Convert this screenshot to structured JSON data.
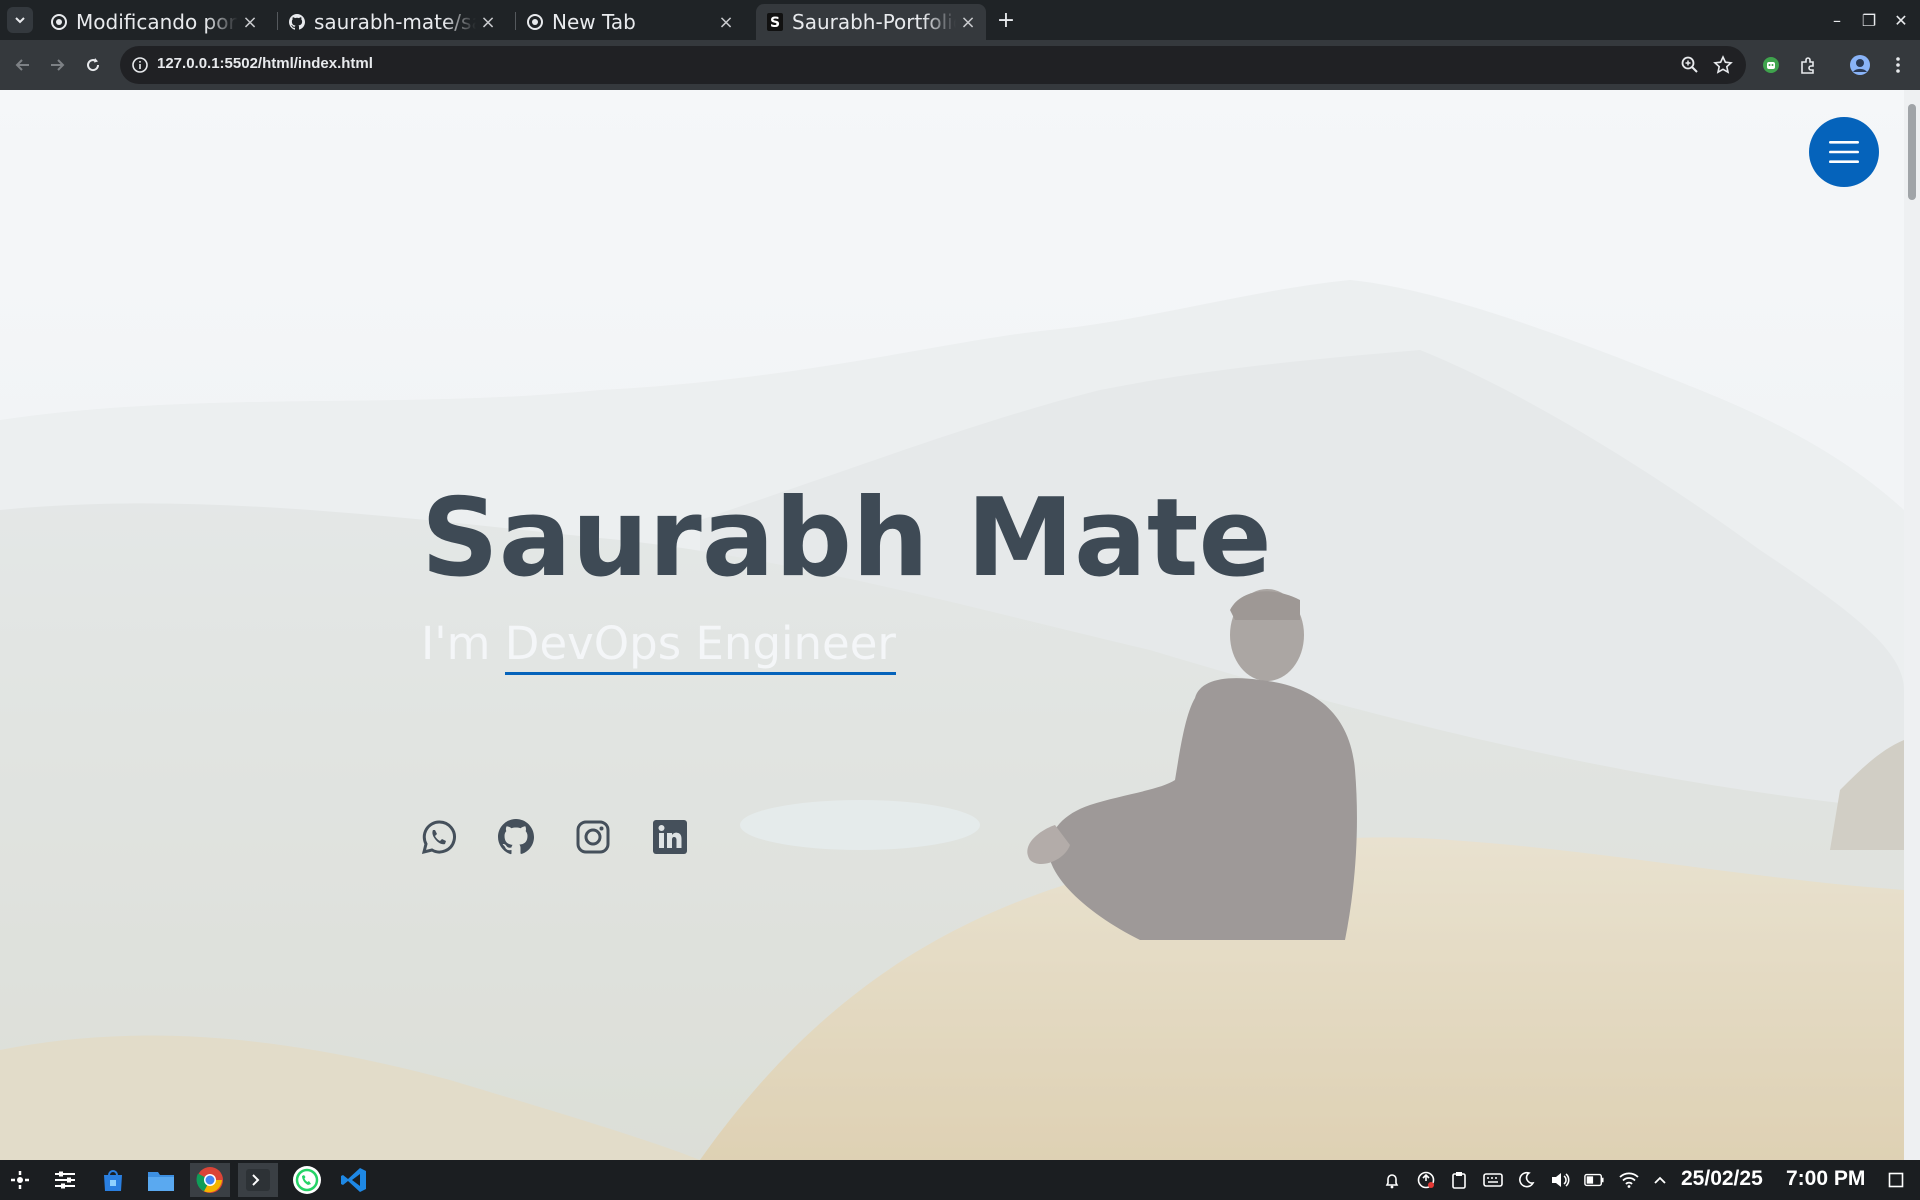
{
  "browser": {
    "tabs": [
      {
        "title": "Modificando portfolio",
        "favicon": "chrome-icon",
        "active": false
      },
      {
        "title": "saurabh-mate/saurabh-mate",
        "favicon": "github-icon",
        "active": false
      },
      {
        "title": "New Tab",
        "favicon": "chrome-icon",
        "active": false
      },
      {
        "title": "Saurabh-Portfolio",
        "favicon": "s-letter-icon",
        "active": true
      }
    ],
    "tab_close_glyph": "×",
    "new_tab_glyph": "+",
    "url": "127.0.0.1:5502/html/index.html",
    "window_controls": {
      "minimize": "–",
      "restore": "❐",
      "close": "✕"
    }
  },
  "page": {
    "name": "Saurabh Mate",
    "subtitle_prefix": "I'm",
    "subtitle_typed": "DevOps Engineer",
    "accent_color": "#0563bb",
    "social_links": [
      "whatsapp-icon",
      "github-icon",
      "instagram-icon",
      "linkedin-icon"
    ]
  },
  "taskbar": {
    "apps": [
      "launcher-icon",
      "settings-panel-icon",
      "store-icon",
      "files-icon",
      "chrome-icon",
      "terminal-icon",
      "whatsapp-icon",
      "vscode-icon"
    ],
    "date": "25/02/25",
    "time": "7:00 PM"
  }
}
